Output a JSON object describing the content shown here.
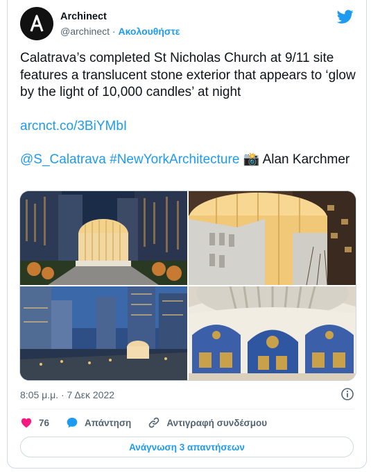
{
  "author": {
    "name": "Archinect",
    "handle": "@archinect",
    "separator": " · ",
    "follow_label": "Ακολουθήστε",
    "avatar_icon": "archinect-logo-icon"
  },
  "tweet": {
    "text_line": "Calatrava’s completed St Nicholas Church at 9/11 site features a translucent stone exterior that appears to ‘glow by the light of 10,000 candles’ at night",
    "link": "arcnct.co/3BiYMbI",
    "mention": "@S_Calatrava",
    "hashtag": "#NewYorkArchitecture",
    "camera_emoji": "📸",
    "credit": "Alan Karchmer"
  },
  "photos": [
    {
      "icon": "church-night-photo"
    },
    {
      "icon": "church-closeup-photo"
    },
    {
      "icon": "wtc-dusk-photo"
    },
    {
      "icon": "church-interior-dome-photo"
    }
  ],
  "timestamp": "8:05 μ.μ. · 7 Δεκ 2022",
  "actions": {
    "like_count": "76",
    "reply_label": "Απάντηση",
    "copy_link_label": "Αντιγραφή συνδέσμου"
  },
  "read_replies_label": "Ανάγνωση 3 απαντήσεων",
  "colors": {
    "accent": "#1d9bf0",
    "like": "#f91880",
    "text": "#0f1419",
    "muted": "#536471"
  }
}
